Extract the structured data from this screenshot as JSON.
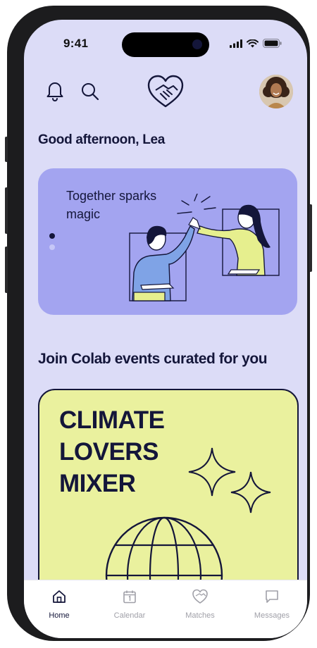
{
  "status_bar": {
    "time": "9:41"
  },
  "header": {
    "icons": [
      "bell-icon",
      "search-icon",
      "heart-handshake-logo-icon"
    ],
    "avatar": "user-avatar"
  },
  "greeting": "Good afternoon, Lea",
  "hero": {
    "text": "Together sparks magic",
    "carousel_dots": 2,
    "active_dot": 1
  },
  "section": {
    "title": "Join Colab events curated for you"
  },
  "event_card": {
    "title_lines": [
      "CLIMATE",
      "LOVERS",
      "MIXER"
    ]
  },
  "tab_bar": {
    "tabs": [
      {
        "label": "Home",
        "icon": "home-icon",
        "active": true
      },
      {
        "label": "Calendar",
        "icon": "calendar-icon",
        "active": false
      },
      {
        "label": "Matches",
        "icon": "matches-icon",
        "active": false
      },
      {
        "label": "Messages",
        "icon": "messages-icon",
        "active": false
      }
    ]
  },
  "colors": {
    "background": "#dcdcf7",
    "hero_card": "#a3a4f0",
    "event_card": "#eaf19e",
    "ink": "#14163a"
  }
}
